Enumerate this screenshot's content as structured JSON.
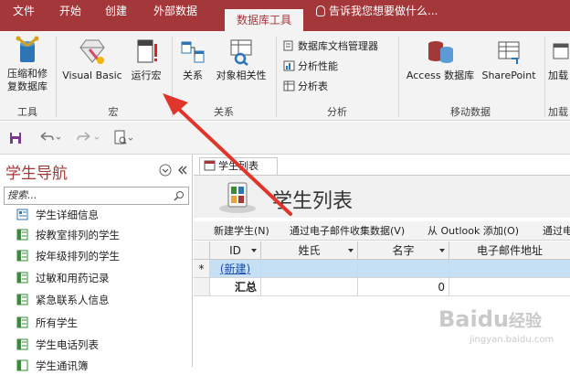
{
  "tabs": [
    {
      "label": "文件"
    },
    {
      "label": "开始"
    },
    {
      "label": "创建"
    },
    {
      "label": "外部数据"
    },
    {
      "label": "数据库工具"
    }
  ],
  "tell_me": "告诉我您想要做什么...",
  "ribbon": {
    "groups": {
      "tools": "工具",
      "macro": "宏",
      "relations": "关系",
      "analyze": "分析",
      "move_data": "移动数据",
      "addins": "加载"
    },
    "buttons": {
      "compact_line1": "压缩和修",
      "compact_line2": "复数据库",
      "visual_basic": "Visual Basic",
      "run_macro": "运行宏",
      "relationships": "关系",
      "object_dependencies": "对象相关性",
      "documenter": "数据库文档管理器",
      "analyze_performance": "分析性能",
      "analyze_table": "分析表",
      "access_db": "Access 数据库",
      "sharepoint": "SharePoint",
      "addins": "加载"
    }
  },
  "nav": {
    "title": "学生导航",
    "search_placeholder": "搜索...",
    "items": [
      {
        "label": "学生详细信息"
      },
      {
        "label": "按教室排列的学生"
      },
      {
        "label": "按年级排列的学生"
      },
      {
        "label": "过敏和用药记录"
      },
      {
        "label": "紧急联系人信息"
      },
      {
        "label": "所有学生"
      },
      {
        "label": "学生电话列表"
      },
      {
        "label": "学生通讯簿"
      }
    ]
  },
  "document": {
    "tab_label": "学生列表",
    "form_title": "学生列表",
    "form_actions": [
      {
        "label": "新建学生(N)"
      },
      {
        "label": "通过电子邮件收集数据(V)"
      },
      {
        "label": "从 Outlook 添加(O)"
      },
      {
        "label": "通过电"
      }
    ],
    "columns": [
      {
        "label": "ID"
      },
      {
        "label": "姓氏"
      },
      {
        "label": "名字"
      },
      {
        "label": "电子邮件地址"
      }
    ],
    "new_row_marker": "*",
    "new_row_label": "(新建)",
    "total_label": "汇总",
    "total_value": "0"
  },
  "watermark": {
    "brand": "Baidu",
    "brand_cn": "经验",
    "url": "jingyan.baidu.com"
  },
  "colors": {
    "accent": "#a4373a",
    "annotation_arrow": "#e0352b",
    "selected_row": "#c5dff5"
  }
}
